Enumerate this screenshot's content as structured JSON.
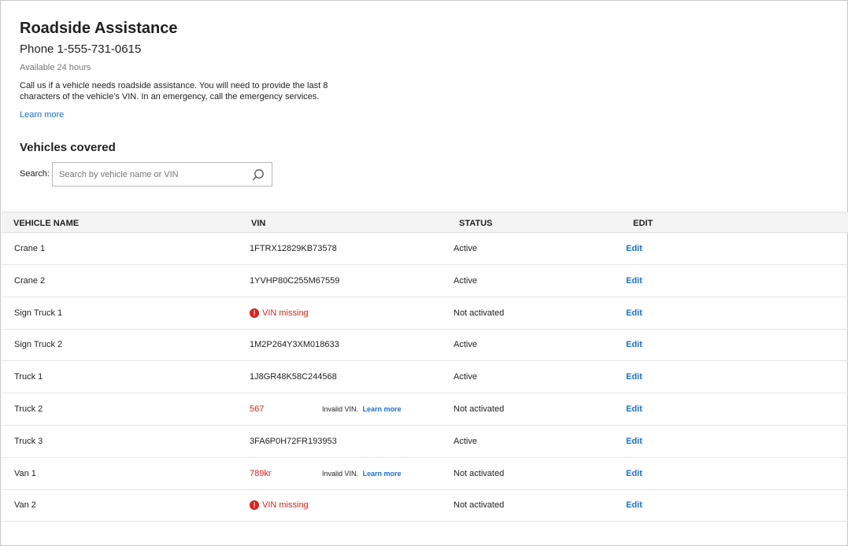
{
  "header": {
    "title": "Roadside Assistance",
    "phone": "Phone 1-555-731-0615",
    "availability": "Available 24 hours",
    "description": "Call us if a vehicle needs roadside assistance. You will need to provide the last 8 characters of the vehicle's VIN. In an emergency, call the emergency services.",
    "learn_more": "Learn more"
  },
  "vehicles": {
    "section_title": "Vehicles covered",
    "search_label": "Search:",
    "search_placeholder": "Search by vehicle name or VIN",
    "search_value": ""
  },
  "table": {
    "columns": [
      "VEHICLE NAME",
      "VIN",
      "STATUS",
      "EDIT"
    ],
    "edit_label": "Edit",
    "invalid_label": "Invalid VIN.",
    "invalid_link": "Learn more",
    "vin_missing": "VIN missing",
    "rows": [
      {
        "name": "Crane 1",
        "vin": "1FTRX12829KB73578",
        "vin_state": "ok",
        "status": "Active"
      },
      {
        "name": "Crane 2",
        "vin": "1YVHP80C255M67559",
        "vin_state": "ok",
        "status": "Active"
      },
      {
        "name": "Sign Truck 1",
        "vin": "",
        "vin_state": "missing",
        "status": "Not activated"
      },
      {
        "name": "Sign Truck 2",
        "vin": "1M2P264Y3XM018633",
        "vin_state": "ok",
        "status": "Active"
      },
      {
        "name": "Truck 1",
        "vin": "1J8GR48K58C244568",
        "vin_state": "ok",
        "status": "Active"
      },
      {
        "name": "Truck 2",
        "vin": "567",
        "vin_state": "invalid",
        "status": "Not activated"
      },
      {
        "name": "Truck 3",
        "vin": "3FA6P0H72FR193953",
        "vin_state": "ok",
        "status": "Active"
      },
      {
        "name": "Van 1",
        "vin": "789kr",
        "vin_state": "invalid",
        "status": "Not activated"
      },
      {
        "name": "Van 2",
        "vin": "",
        "vin_state": "missing",
        "status": "Not activated"
      }
    ]
  },
  "colors": {
    "link": "#1a6fd8",
    "error": "#e0201b",
    "header_bg": "#f3f3f3"
  }
}
